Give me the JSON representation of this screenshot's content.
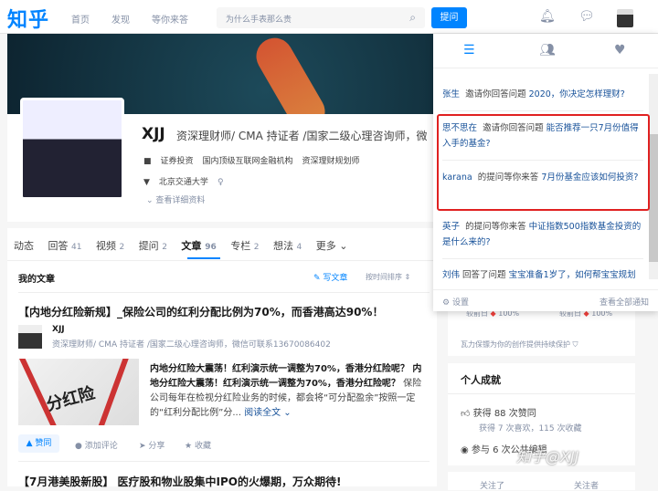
{
  "header": {
    "logo": "知乎",
    "nav": [
      "首页",
      "发现",
      "等你来答"
    ],
    "search_placeholder": "为什么手表那么贵",
    "ask_button": "提问"
  },
  "profile": {
    "name": "XJJ",
    "headline": "资深理财师/ CMA 持证者 /国家二级心理咨询师，微",
    "industry": "证券投资",
    "company": "国内顶级互联网金融机构",
    "position": "资深理财规划师",
    "school": "北京交通大学",
    "gender_icon": "♀",
    "more": "查看详细资料"
  },
  "tabs": [
    {
      "label": "动态",
      "count": ""
    },
    {
      "label": "回答",
      "count": "41"
    },
    {
      "label": "视频",
      "count": "2"
    },
    {
      "label": "提问",
      "count": "2"
    },
    {
      "label": "文章",
      "count": "96"
    },
    {
      "label": "专栏",
      "count": "2"
    },
    {
      "label": "想法",
      "count": "4"
    },
    {
      "label": "更多 ⌄",
      "count": ""
    }
  ],
  "articles": {
    "section_title": "我的文章",
    "write": "写文章",
    "sort": "按时间排序",
    "items": [
      {
        "title": "【内地分红险新规】_保险公司的红利分配比例为70%，而香港高达90%！",
        "author": "XJJ",
        "author_desc": "资深理财师/ CMA 持证者 /国家二级心理咨询师，微信可联系13670086402",
        "thumb_text": "分红险",
        "excerpt_bold": "内地分红险大震荡！红利演示统一调整为70%，香港分红险呢？ 内地分红险大震荡！红利演示统一调整为70%，香港分红险呢？",
        "excerpt": " 保险公司每年在检视分红险业务的时候，都会将“可分配盈余”按照一定的“红利分配比例”分...",
        "read_more": "阅读全文 ⌄",
        "vote": "▲ 赞同",
        "comment": "添加评论",
        "share": "分享",
        "favorite": "收藏"
      },
      {
        "title": "【7月港美股新股】 医疗股和物业股集中IPO的火爆期，万众期待!"
      }
    ]
  },
  "notifications": {
    "items": [
      {
        "user": "张生",
        "action": "邀请你回答问题",
        "question": "2020，你决定怎样理财?"
      },
      {
        "user": "思不思在",
        "action": "邀请你回答问题",
        "question": "能否推荐一只7月份值得入手的基金?"
      },
      {
        "user": "karana",
        "action": "的提问等你来答",
        "question": "7月份基金应该如何投资?"
      },
      {
        "user": "英子",
        "action": "的提问等你来答",
        "question": "中证指数500指数基金投资的是什么来的?"
      },
      {
        "user": "刘伟",
        "action": "回答了问题",
        "question": "宝宝准备1岁了，如何帮宝宝规划"
      }
    ],
    "settings": "设置",
    "view_all": "查看全部通知"
  },
  "sidebar": {
    "stat_label": "较前日",
    "stat_value": "100%",
    "protect": "瓦力保镖为你的创作提供持续保护",
    "achievements_title": "个人成就",
    "likes": "获得 88 次赞同",
    "likes_sub": "获得 7 次喜欢，115 次收藏",
    "edits": "参与 6 次公共编辑",
    "following": "关注了",
    "followers": "关注者"
  },
  "watermark": "知乎@XJJ"
}
